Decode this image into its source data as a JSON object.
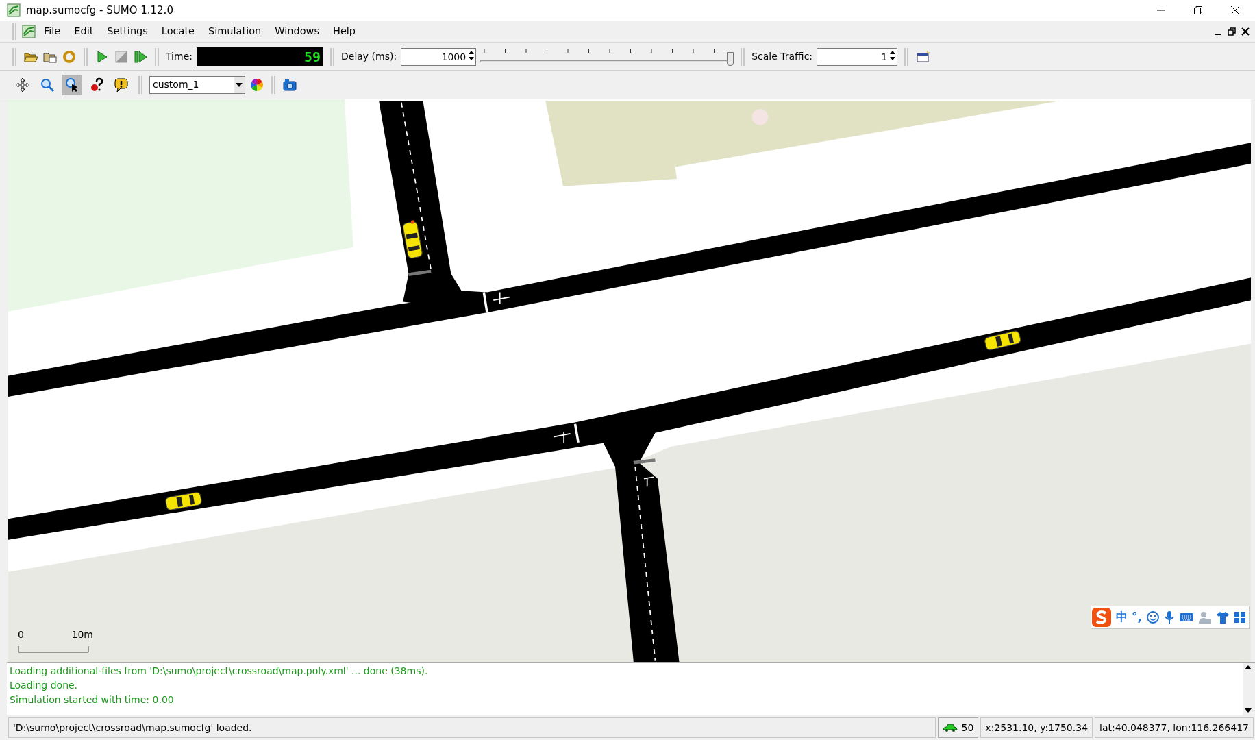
{
  "window": {
    "title": "map.sumocfg - SUMO 1.12.0"
  },
  "menu": [
    {
      "label": "File"
    },
    {
      "label": "Edit"
    },
    {
      "label": "Settings"
    },
    {
      "label": "Locate"
    },
    {
      "label": "Simulation"
    },
    {
      "label": "Windows"
    },
    {
      "label": "Help"
    }
  ],
  "toolbar": {
    "time_label": "Time:",
    "time_value": "59",
    "delay_label": "Delay (ms):",
    "delay_value": "1000",
    "delay_slider": {
      "level": 1.0
    },
    "scale_label": "Scale Traffic:",
    "scale_value": "1"
  },
  "view_tools": [
    {
      "selected": false
    },
    {
      "selected": false
    },
    {
      "selected": true
    },
    {
      "selected": false
    },
    {
      "selected": false
    }
  ],
  "view_scheme": "custom_1",
  "map": {
    "scale_start": "0",
    "scale_end": "10m"
  },
  "ime": {
    "language": "中",
    "punctuation": "°,"
  },
  "log": [
    {
      "text": "Loading additional-files from 'D:\\sumo\\project\\crossroad\\map.poly.xml' ... done (38ms)."
    },
    {
      "text": "Loading done."
    },
    {
      "text": "Simulation started with time: 0.00"
    }
  ],
  "status_bar": {
    "message": "'D:\\sumo\\project\\crossroad\\map.sumocfg' loaded.",
    "vehicles": "50",
    "position": "x:2531.10, y:1750.34",
    "geo": "lat:40.048377, lon:116.266417"
  }
}
